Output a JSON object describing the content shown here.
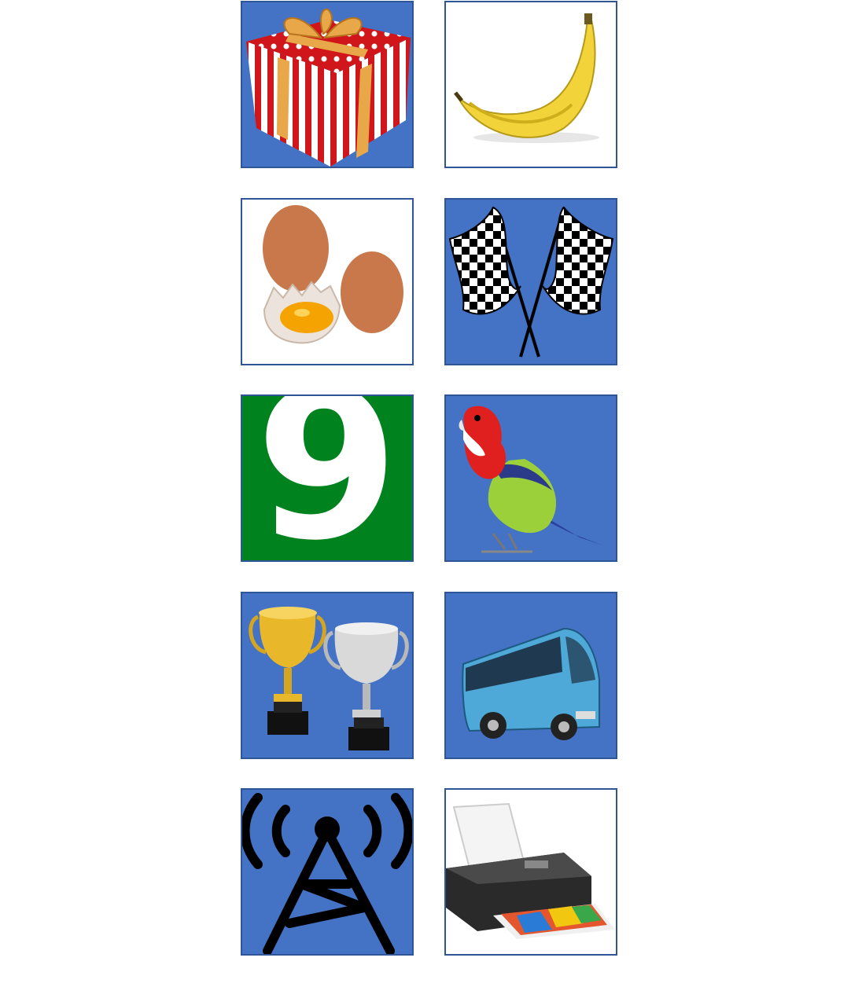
{
  "tiles": [
    {
      "name": "gift-box",
      "background": "#4472c4"
    },
    {
      "name": "banana",
      "background": "#ffffff"
    },
    {
      "name": "eggs",
      "background": "#ffffff"
    },
    {
      "name": "checkered-flags",
      "background": "#4472c4"
    },
    {
      "name": "number-nine",
      "background": "#00821e",
      "text": "9"
    },
    {
      "name": "parrot",
      "background": "#4472c4"
    },
    {
      "name": "trophies",
      "background": "#4472c4"
    },
    {
      "name": "bus",
      "background": "#4472c4"
    },
    {
      "name": "radio-tower",
      "background": "#4472c4"
    },
    {
      "name": "printer",
      "background": "#ffffff"
    }
  ],
  "colors": {
    "tile_blue": "#4472c4",
    "tile_border": "#2f5597",
    "tile_green": "#00821e"
  }
}
